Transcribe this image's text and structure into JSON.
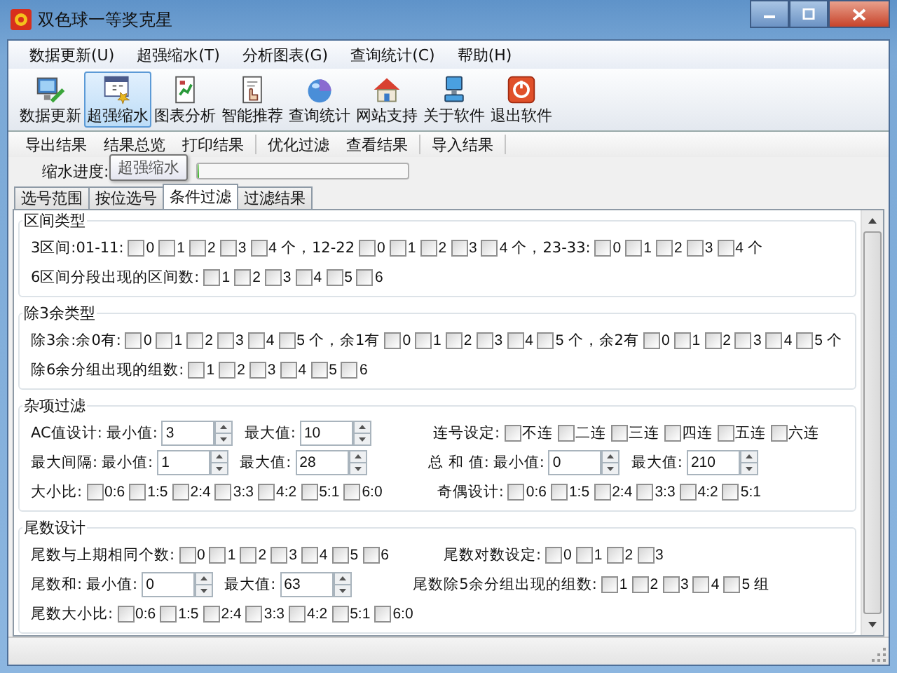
{
  "window": {
    "title": "双色球一等奖克星"
  },
  "menu": [
    {
      "label": "数据更新(U)"
    },
    {
      "label": "超强缩水(T)"
    },
    {
      "label": "分析图表(G)"
    },
    {
      "label": "查询统计(C)"
    },
    {
      "label": "帮助(H)"
    }
  ],
  "toolbar": [
    {
      "label": "数据更新",
      "kind": "monitor",
      "selected": false
    },
    {
      "label": "超强缩水",
      "kind": "window",
      "selected": true
    },
    {
      "label": "图表分析",
      "kind": "chart",
      "selected": false
    },
    {
      "label": "智能推荐",
      "kind": "document",
      "selected": false
    },
    {
      "label": "查询统计",
      "kind": "sphere",
      "selected": false
    },
    {
      "label": "网站支持",
      "kind": "house",
      "selected": false
    },
    {
      "label": "关于软件",
      "kind": "computer",
      "selected": false
    },
    {
      "label": "退出软件",
      "kind": "power",
      "selected": false
    }
  ],
  "subtoolbar": [
    {
      "items": [
        "导出结果",
        "结果总览",
        "打印结果"
      ]
    },
    {
      "items": [
        "优化过滤",
        "查看结果"
      ]
    },
    {
      "items": [
        "导入结果"
      ]
    }
  ],
  "tooltip": "超强缩水",
  "progress": {
    "label": "缩水进度:",
    "level": 0
  },
  "tabs": [
    {
      "label": "选号范围",
      "selected": false
    },
    {
      "label": "按位选号",
      "selected": false
    },
    {
      "label": "条件过滤",
      "selected": true
    },
    {
      "label": "过滤结果",
      "selected": false
    }
  ],
  "sections": [
    {
      "title": "区间类型",
      "rows": [
        {
          "groups": [
            {
              "items": [
                {
                  "kind": "text",
                  "text": "3区间:01-11:"
                },
                {
                  "kind": "checks",
                  "options": [
                    {
                      "label": "0",
                      "checked": false
                    },
                    {
                      "label": "1",
                      "checked": false
                    },
                    {
                      "label": "2",
                      "checked": false
                    },
                    {
                      "label": "3",
                      "checked": false
                    },
                    {
                      "label": "4",
                      "checked": false
                    }
                  ]
                },
                {
                  "kind": "text",
                  "text": "个，12-22"
                },
                {
                  "kind": "checks",
                  "options": [
                    {
                      "label": "0",
                      "checked": false
                    },
                    {
                      "label": "1",
                      "checked": false
                    },
                    {
                      "label": "2",
                      "checked": false
                    },
                    {
                      "label": "3",
                      "checked": false
                    },
                    {
                      "label": "4",
                      "checked": false
                    }
                  ]
                },
                {
                  "kind": "text",
                  "text": "个，23-33:"
                },
                {
                  "kind": "checks",
                  "options": [
                    {
                      "label": "0",
                      "checked": false
                    },
                    {
                      "label": "1",
                      "checked": false
                    },
                    {
                      "label": "2",
                      "checked": false
                    },
                    {
                      "label": "3",
                      "checked": false
                    },
                    {
                      "label": "4",
                      "checked": false
                    }
                  ]
                },
                {
                  "kind": "text",
                  "text": "个"
                }
              ]
            }
          ]
        },
        {
          "groups": [
            {
              "items": [
                {
                  "kind": "text",
                  "text": "6区间分段出现的区间数:"
                },
                {
                  "kind": "checks",
                  "options": [
                    {
                      "label": "1",
                      "checked": false
                    },
                    {
                      "label": "2",
                      "checked": false
                    },
                    {
                      "label": "3",
                      "checked": false
                    },
                    {
                      "label": "4",
                      "checked": false
                    },
                    {
                      "label": "5",
                      "checked": false
                    },
                    {
                      "label": "6",
                      "checked": false
                    }
                  ]
                }
              ]
            }
          ]
        }
      ]
    },
    {
      "title": "除3余类型",
      "rows": [
        {
          "groups": [
            {
              "items": [
                {
                  "kind": "text",
                  "text": "除3余:余0有:"
                },
                {
                  "kind": "checks",
                  "options": [
                    {
                      "label": "0",
                      "checked": false
                    },
                    {
                      "label": "1",
                      "checked": false
                    },
                    {
                      "label": "2",
                      "checked": false
                    },
                    {
                      "label": "3",
                      "checked": false
                    },
                    {
                      "label": "4",
                      "checked": false
                    },
                    {
                      "label": "5",
                      "checked": false
                    }
                  ]
                },
                {
                  "kind": "text",
                  "text": "个，余1有"
                },
                {
                  "kind": "checks",
                  "options": [
                    {
                      "label": "0",
                      "checked": false
                    },
                    {
                      "label": "1",
                      "checked": false
                    },
                    {
                      "label": "2",
                      "checked": false
                    },
                    {
                      "label": "3",
                      "checked": false
                    },
                    {
                      "label": "4",
                      "checked": false
                    },
                    {
                      "label": "5",
                      "checked": false
                    }
                  ]
                },
                {
                  "kind": "text",
                  "text": "个，余2有"
                },
                {
                  "kind": "checks",
                  "options": [
                    {
                      "label": "0",
                      "checked": false
                    },
                    {
                      "label": "1",
                      "checked": false
                    },
                    {
                      "label": "2",
                      "checked": false
                    },
                    {
                      "label": "3",
                      "checked": false
                    },
                    {
                      "label": "4",
                      "checked": false
                    },
                    {
                      "label": "5",
                      "checked": false
                    }
                  ]
                },
                {
                  "kind": "text",
                  "text": "个"
                }
              ]
            }
          ]
        },
        {
          "groups": [
            {
              "items": [
                {
                  "kind": "text",
                  "text": "除6余分组出现的组数:"
                },
                {
                  "kind": "checks",
                  "options": [
                    {
                      "label": "1",
                      "checked": false
                    },
                    {
                      "label": "2",
                      "checked": false
                    },
                    {
                      "label": "3",
                      "checked": false
                    },
                    {
                      "label": "4",
                      "checked": false
                    },
                    {
                      "label": "5",
                      "checked": false
                    },
                    {
                      "label": "6",
                      "checked": false
                    }
                  ]
                }
              ]
            }
          ]
        }
      ]
    },
    {
      "title": "杂项过滤",
      "rows": [
        {
          "groups": [
            {
              "items": [
                {
                  "kind": "text",
                  "text": "AC值设计:"
                },
                {
                  "kind": "text",
                  "text": "最小值:"
                },
                {
                  "kind": "spin",
                  "value": "3"
                },
                {
                  "kind": "text",
                  "text": "最大值:"
                },
                {
                  "kind": "spin",
                  "value": "10"
                }
              ]
            },
            {
              "items": [
                {
                  "kind": "text",
                  "text": "连号设定:"
                },
                {
                  "kind": "checks",
                  "options": [
                    {
                      "label": "不连",
                      "checked": false
                    },
                    {
                      "label": "二连",
                      "checked": false
                    },
                    {
                      "label": "三连",
                      "checked": false
                    },
                    {
                      "label": "四连",
                      "checked": false
                    },
                    {
                      "label": "五连",
                      "checked": false
                    },
                    {
                      "label": "六连",
                      "checked": false
                    }
                  ]
                }
              ]
            }
          ]
        },
        {
          "groups": [
            {
              "items": [
                {
                  "kind": "text",
                  "text": "最大间隔:"
                },
                {
                  "kind": "text",
                  "text": "最小值:"
                },
                {
                  "kind": "spin",
                  "value": "1"
                },
                {
                  "kind": "text",
                  "text": "最大值:"
                },
                {
                  "kind": "spin",
                  "value": "28"
                }
              ]
            },
            {
              "items": [
                {
                  "kind": "text",
                  "text": "总 和 值:"
                },
                {
                  "kind": "text",
                  "text": "最小值:"
                },
                {
                  "kind": "spin",
                  "value": "0"
                },
                {
                  "kind": "text",
                  "text": "最大值:"
                },
                {
                  "kind": "spin",
                  "value": "210"
                }
              ]
            }
          ]
        },
        {
          "groups": [
            {
              "items": [
                {
                  "kind": "text",
                  "text": "大小比:"
                },
                {
                  "kind": "checks",
                  "options": [
                    {
                      "label": "0:6",
                      "checked": false
                    },
                    {
                      "label": "1:5",
                      "checked": false
                    },
                    {
                      "label": "2:4",
                      "checked": false
                    },
                    {
                      "label": "3:3",
                      "checked": false
                    },
                    {
                      "label": "4:2",
                      "checked": false
                    },
                    {
                      "label": "5:1",
                      "checked": false
                    },
                    {
                      "label": "6:0",
                      "checked": false
                    }
                  ]
                }
              ]
            },
            {
              "items": [
                {
                  "kind": "text",
                  "text": "奇偶设计:"
                },
                {
                  "kind": "checks",
                  "options": [
                    {
                      "label": "0:6",
                      "checked": false
                    },
                    {
                      "label": "1:5",
                      "checked": false
                    },
                    {
                      "label": "2:4",
                      "checked": false
                    },
                    {
                      "label": "3:3",
                      "checked": false
                    },
                    {
                      "label": "4:2",
                      "checked": false
                    },
                    {
                      "label": "5:1",
                      "checked": false
                    }
                  ]
                }
              ]
            }
          ]
        }
      ]
    },
    {
      "title": "尾数设计",
      "rows": [
        {
          "groups": [
            {
              "items": [
                {
                  "kind": "text",
                  "text": "尾数与上期相同个数:"
                },
                {
                  "kind": "checks",
                  "options": [
                    {
                      "label": "0",
                      "checked": false
                    },
                    {
                      "label": "1",
                      "checked": false
                    },
                    {
                      "label": "2",
                      "checked": false
                    },
                    {
                      "label": "3",
                      "checked": false
                    },
                    {
                      "label": "4",
                      "checked": false
                    },
                    {
                      "label": "5",
                      "checked": false
                    },
                    {
                      "label": "6",
                      "checked": false
                    }
                  ]
                }
              ]
            },
            {
              "items": [
                {
                  "kind": "text",
                  "text": "尾数对数设定:"
                },
                {
                  "kind": "checks",
                  "options": [
                    {
                      "label": "0",
                      "checked": false
                    },
                    {
                      "label": "1",
                      "checked": false
                    },
                    {
                      "label": "2",
                      "checked": false
                    },
                    {
                      "label": "3",
                      "checked": false
                    }
                  ]
                }
              ]
            }
          ]
        },
        {
          "groups": [
            {
              "items": [
                {
                  "kind": "text",
                  "text": "尾数和:"
                },
                {
                  "kind": "text",
                  "text": "最小值:"
                },
                {
                  "kind": "spin",
                  "value": "0"
                },
                {
                  "kind": "text",
                  "text": "最大值:"
                },
                {
                  "kind": "spin",
                  "value": "63"
                }
              ]
            },
            {
              "items": [
                {
                  "kind": "text",
                  "text": "尾数除5余分组出现的组数:"
                },
                {
                  "kind": "checks",
                  "options": [
                    {
                      "label": "1",
                      "checked": false
                    },
                    {
                      "label": "2",
                      "checked": false
                    },
                    {
                      "label": "3",
                      "checked": false
                    },
                    {
                      "label": "4",
                      "checked": false
                    },
                    {
                      "label": "5",
                      "checked": false
                    }
                  ]
                },
                {
                  "kind": "text",
                  "text": "组"
                }
              ]
            }
          ]
        },
        {
          "groups": [
            {
              "items": [
                {
                  "kind": "text",
                  "text": "尾数大小比:"
                },
                {
                  "kind": "checks",
                  "options": [
                    {
                      "label": "0:6",
                      "checked": false
                    },
                    {
                      "label": "1:5",
                      "checked": false
                    },
                    {
                      "label": "2:4",
                      "checked": false
                    },
                    {
                      "label": "3:3",
                      "checked": false
                    },
                    {
                      "label": "4:2",
                      "checked": false
                    },
                    {
                      "label": "5:1",
                      "checked": false
                    },
                    {
                      "label": "6:0",
                      "checked": false
                    }
                  ]
                }
              ]
            }
          ]
        }
      ]
    }
  ]
}
